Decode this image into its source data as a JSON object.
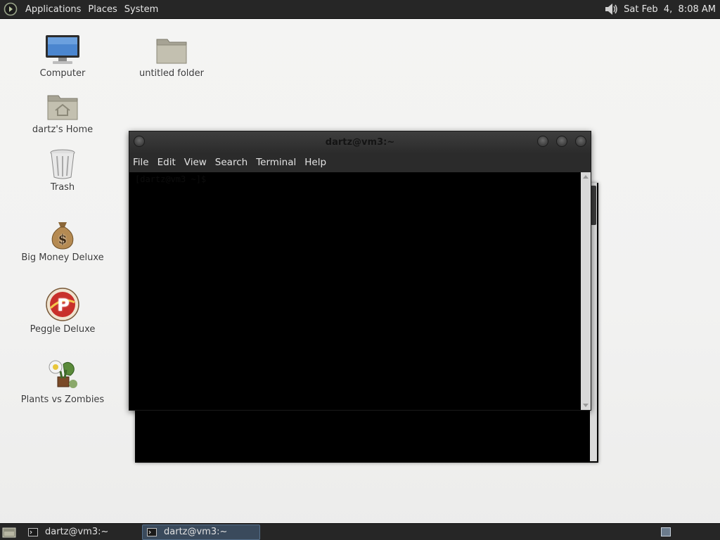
{
  "top_panel": {
    "menus": [
      "Applications",
      "Places",
      "System"
    ],
    "clock": "Sat Feb  4,  8:08 AM",
    "icons": {
      "logo": "gnome-foot-icon",
      "volume": "speaker-volume-icon"
    }
  },
  "desktop": {
    "icons": [
      {
        "label": "Computer",
        "icon": "computer-monitor-icon"
      },
      {
        "label": "untitled folder",
        "icon": "folder-icon"
      },
      {
        "label": "dartz's Home",
        "icon": "home-folder-icon"
      },
      {
        "label": "Trash",
        "icon": "trash-icon"
      },
      {
        "label": "Big Money Deluxe",
        "icon": "money-bag-icon"
      },
      {
        "label": "Peggle Deluxe",
        "icon": "peggle-icon"
      },
      {
        "label": "Plants vs Zombies",
        "icon": "plants-vs-zombies-icon"
      }
    ]
  },
  "terminal": {
    "title": "dartz@vm3:~",
    "menu": [
      "File",
      "Edit",
      "View",
      "Search",
      "Terminal",
      "Help"
    ],
    "prompt": "[dartz@vm3 ~]$"
  },
  "taskbar": {
    "tasks": [
      "dartz@vm3:~",
      "dartz@vm3:~"
    ]
  },
  "colors": {
    "panel": "#262626",
    "desktop": "#f2f2f1",
    "active_task": "#3a4a5c"
  }
}
